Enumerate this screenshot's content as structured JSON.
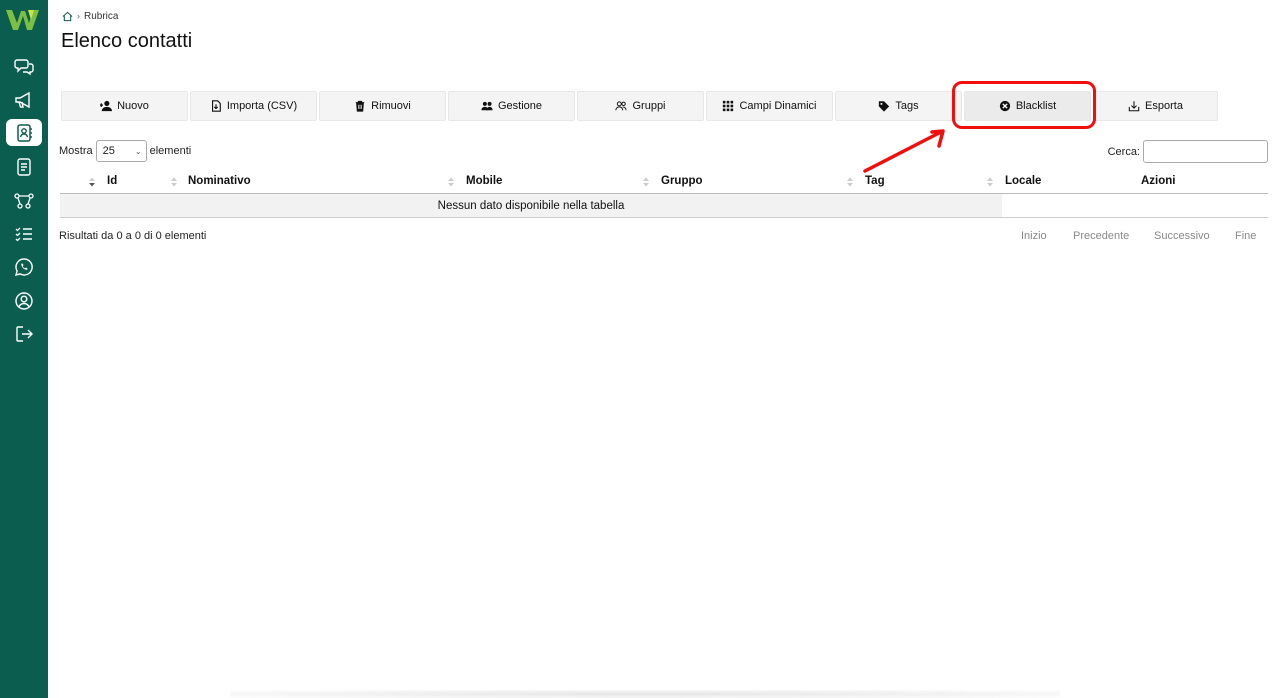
{
  "colors": {
    "sidebar": "#0b5e4f",
    "accent_green": "#7bc043",
    "annotation_red": "#f00e0e"
  },
  "sidebar": {
    "logo": "w-logo",
    "items": [
      {
        "icon": "chat-bubbles-icon",
        "active": false
      },
      {
        "icon": "megaphone-icon",
        "active": false
      },
      {
        "icon": "contact-book-icon",
        "active": true
      },
      {
        "icon": "document-icon",
        "active": false
      },
      {
        "icon": "flow-nodes-icon",
        "active": false
      },
      {
        "icon": "checklist-icon",
        "active": false
      },
      {
        "icon": "whatsapp-icon",
        "active": false
      },
      {
        "icon": "user-circle-icon",
        "active": false
      },
      {
        "icon": "logout-icon",
        "active": false
      }
    ]
  },
  "breadcrumb": {
    "current": "Rubrica",
    "separator": "›"
  },
  "page_title": "Elenco contatti",
  "toolbar": {
    "buttons": [
      {
        "label": "Nuovo",
        "icon": "add-user-icon"
      },
      {
        "label": "Importa (CSV)",
        "icon": "file-import-icon"
      },
      {
        "label": "Rimuovi",
        "icon": "trash-icon"
      },
      {
        "label": "Gestione",
        "icon": "users-icon"
      },
      {
        "label": "Gruppi",
        "icon": "group-outline-icon"
      },
      {
        "label": "Campi Dinamici",
        "icon": "grid-dots-icon"
      },
      {
        "label": "Tags",
        "icon": "tag-icon"
      },
      {
        "label": "Blacklist",
        "icon": "x-circle-icon"
      },
      {
        "label": "Esporta",
        "icon": "download-icon"
      }
    ]
  },
  "table_controls": {
    "show_label": "Mostra",
    "page_size": "25",
    "elements_label": "elementi",
    "search_label": "Cerca:",
    "search_value": ""
  },
  "table": {
    "columns": [
      "Id",
      "Nominativo",
      "Mobile",
      "Gruppo",
      "Tag",
      "Locale",
      "Azioni"
    ],
    "sorted_column": "Id",
    "empty_message": "Nessun dato disponibile nella tabella"
  },
  "info_text": "Risultati da 0 a 0 di 0 elementi",
  "pagination": {
    "first": "Inizio",
    "previous": "Precedente",
    "next": "Successivo",
    "last": "Fine"
  }
}
